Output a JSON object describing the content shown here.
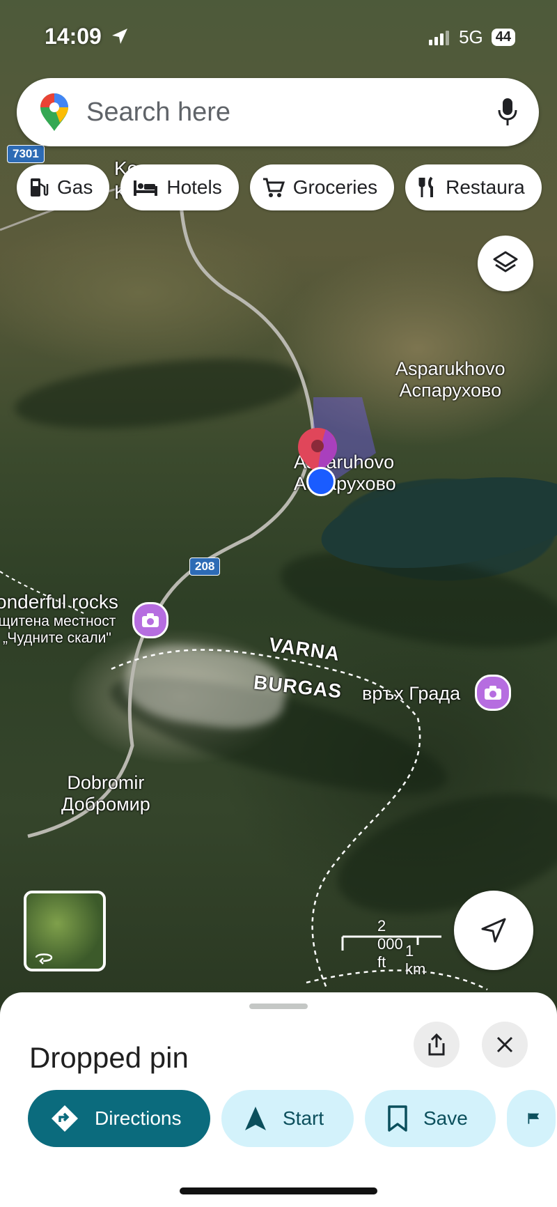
{
  "status_bar": {
    "time": "14:09",
    "network": "5G",
    "battery": "44"
  },
  "search": {
    "placeholder": "Search here"
  },
  "chips": [
    {
      "label": "Gas",
      "icon": "gas-icon"
    },
    {
      "label": "Hotels",
      "icon": "hotel-icon"
    },
    {
      "label": "Groceries",
      "icon": "cart-icon"
    },
    {
      "label": "Restaura",
      "icon": "restaurant-icon"
    }
  ],
  "map": {
    "labels": {
      "top_left_partial_1": "Ko",
      "top_left_partial_2": "Ko",
      "asparukhovo_en": "Asparukhovo",
      "asparukhovo_bg": "Аспарухово",
      "town_en": "Asparuhovo",
      "town_bg": "Аспарухово",
      "rocks_en": "onderful rocks",
      "rocks_bg1": "щитена местност",
      "rocks_bg2": "„Чудните скали\"",
      "region_1": "VARNA",
      "region_2": "BURGAS",
      "peak": "връх Града",
      "village_en": "Dobromir",
      "village_bg": "Добромир"
    },
    "road_shields": [
      "7301",
      "208"
    ],
    "scale": {
      "imperial": "2 000 ft",
      "metric": "1 km"
    }
  },
  "sheet": {
    "title": "Dropped pin",
    "actions": [
      {
        "label": "Directions",
        "icon": "directions-icon"
      },
      {
        "label": "Start",
        "icon": "navigation-arrow-icon"
      },
      {
        "label": "Save",
        "icon": "bookmark-icon"
      }
    ]
  },
  "colors": {
    "primary_action": "#0b6b7d",
    "secondary_action": "#d3f2fb",
    "poi_pin": "#b66de0",
    "location_dot": "#1a5cff",
    "dropped_pin": "#e0465a"
  }
}
